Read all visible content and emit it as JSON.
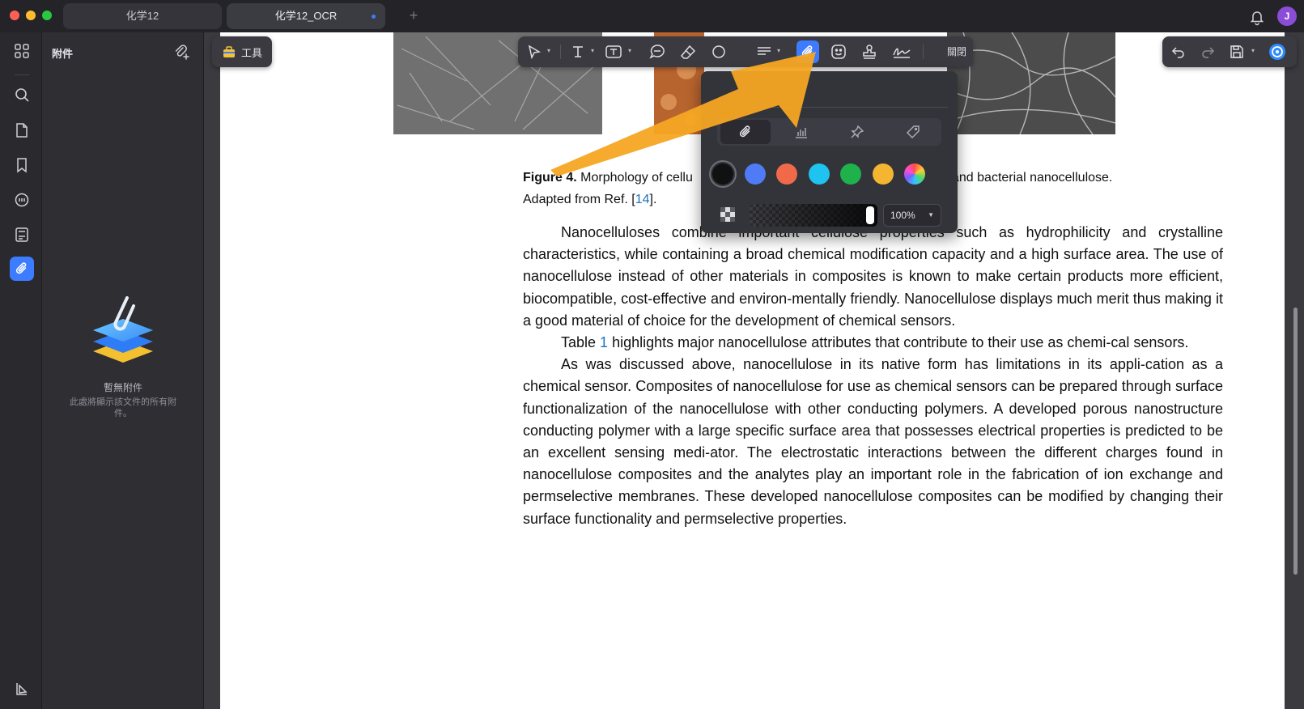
{
  "window": {
    "tabs": [
      {
        "label": "化学12",
        "active": false
      },
      {
        "label": "化学12_OCR",
        "active": true
      }
    ],
    "avatar_initial": "J"
  },
  "panel": {
    "title": "附件",
    "empty_title": "暫無附件",
    "empty_subtitle": "此處將顯示該文件的所有附件。"
  },
  "tool_button": {
    "label": "工具"
  },
  "toolbar": {
    "close_label": "關閉"
  },
  "popup": {
    "colors": [
      "#111111",
      "#4f7cf6",
      "#f06a4a",
      "#1ec3f0",
      "#1fb14b",
      "#f4b631",
      "rainbow"
    ],
    "selected_color_index": 0,
    "opacity_value": "100%",
    "opacity_fraction": 1.0
  },
  "document": {
    "caption_bold": "Figure 4.",
    "caption_part1": " Morphology of cellu",
    "caption_part2": "and bacterial nanocellulose.",
    "caption_line2_prefix": "Adapted from Ref. [",
    "caption_ref": "14",
    "caption_line2_suffix": "].",
    "paragraphs": [
      {
        "before": "Nanocelluloses combine important cellulose properties such as hydrophilicity and crystalline characteristics, while containing a broad chemical modification capacity and a high surface area. The use of nanocellulose instead of other materials in composites is known to make certain products more efficient, biocompatible, cost-effective and environ-mentally friendly. Nanocellulose displays much merit thus making it a good material of choice for the development of chemical sensors.",
        "link": "",
        "after": ""
      },
      {
        "before": "Table ",
        "link": "1",
        "after": " highlights major nanocellulose attributes that contribute to their use as chemi-cal sensors."
      },
      {
        "before": "As was discussed above, nanocellulose in its native form has limitations in its appli-cation as a chemical sensor. Composites of nanocellulose for use as chemical sensors can be prepared through surface functionalization of the nanocellulose with other conducting polymers. A developed porous nanostructure conducting polymer with a large specific surface area that possesses electrical properties is predicted to be an excellent sensing medi-ator. The electrostatic interactions between the different charges found in nanocellulose composites and the analytes play an important role in the fabrication of ion exchange and permselective membranes. These developed nanocellulose composites can be modified by changing their surface functionality and permselective properties.",
        "link": "",
        "after": ""
      }
    ]
  },
  "icons": {
    "rail": [
      "grid-icon",
      "search-icon",
      "page-icon",
      "bookmark-icon",
      "comment-icon",
      "form-icon",
      "attachment-icon"
    ],
    "rail_bottom": "sidebar-toggle-icon",
    "toolbar": [
      "select-icon",
      "text-icon",
      "textbox-icon",
      "note-icon",
      "eraser-icon",
      "shape-icon",
      "area-highlight-icon",
      "attachment-icon",
      "sticker-icon",
      "stamp-icon",
      "signature-icon"
    ],
    "toolbar_right": [
      "undo-icon",
      "redo-icon",
      "save-icon",
      "ai-icon"
    ]
  },
  "colors": {
    "accent": "#3d7bff",
    "annotation_arrow": "#f5a623"
  }
}
